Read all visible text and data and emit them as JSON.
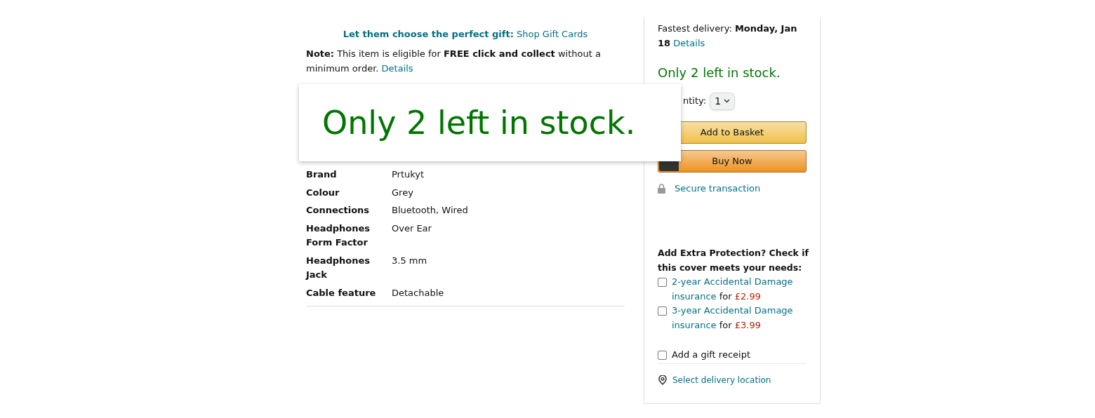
{
  "gift_promo": {
    "label": "Let them choose the perfect gift:",
    "link": "Shop Gift Cards"
  },
  "note": {
    "text": "**Note:** This item is eligible for **FREE click and collect** without a minimum order.",
    "link": "Details"
  },
  "zoom_popup": {
    "text": "Only 2 left in stock."
  },
  "specs": [
    {
      "name": "Brand",
      "value": "Prtukyt"
    },
    {
      "name": "Colour",
      "value": "Grey"
    },
    {
      "name": "Connections",
      "value": "Bluetooth, Wired"
    },
    {
      "name": "Headphones Form Factor",
      "value": "Over Ear"
    },
    {
      "name": "Headphones Jack",
      "value": "3.5 mm"
    },
    {
      "name": "Cable feature",
      "value": "Detachable"
    }
  ],
  "buy_box": {
    "delivery": "Fastest delivery: **Monday, Jan 18**",
    "delivery_link": "Details",
    "stock": "Only 2 left in stock.",
    "quantity_label": "ntity:",
    "quantity": "1",
    "add_to_basket": "Add to Basket",
    "buy_now": "Buy Now",
    "secure": "Secure transaction",
    "protection_heading": "Add Extra Protection? Check if this cover meets your needs:",
    "protection_options": [
      {
        "link": "2-year Accidental Damage insurance",
        "for": "for",
        "price": "£2.99",
        "checked": false
      },
      {
        "link": "3-year Accidental Damage insurance",
        "for": "for",
        "price": "£3.99",
        "checked": false
      }
    ],
    "gift_receipt": {
      "label": "Add a gift receipt",
      "checked": false
    },
    "location": "Select delivery location"
  }
}
